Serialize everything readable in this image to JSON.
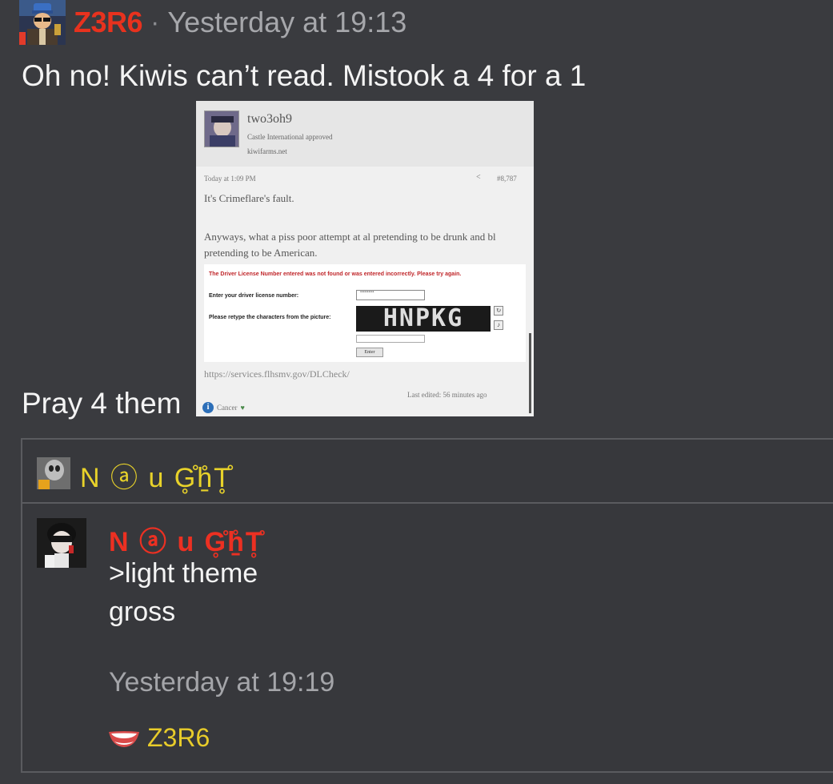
{
  "post": {
    "username": "Z3R6",
    "separator": "·",
    "timestamp": "Yesterday at 19:13",
    "text_line1": "Oh no! Kiwis can’t read. Mistook a 4 for a 1",
    "text_line2": "Pray 4 them"
  },
  "embed": {
    "username": "two3oh9",
    "subtitle1": "Castle International approved",
    "subtitle2": "kiwifarms.net",
    "date": "Today at 1:09 PM",
    "post_number": "#8,787",
    "line1": "It's Crimeflare's fault.",
    "line2": "Anyways, what a piss poor attempt at al pretending to be drunk and bl pretending to be American.",
    "form": {
      "error": "The Driver License Number entered was not found or was entered incorrectly. Please try again.",
      "label1": "Enter your driver license number:",
      "input1_value": "••••••••••",
      "label2": "Please retype the characters from the picture:",
      "captcha": "HNPKG",
      "button": "Enter"
    },
    "url": "https://services.flhsmv.gov/DLCheck/",
    "edited": "Last edited: 56 minutes ago",
    "reaction_label": "Cancer"
  },
  "quote": {
    "author": "N ⓐ u G̥̊ẖ̊T̥̊"
  },
  "reply": {
    "username": "N ⓐ u G̥̊ẖ̊T̥̊",
    "line1": ">light theme",
    "line2": "gross",
    "timestamp": "Yesterday at 19:19",
    "reaction_user": "Z3R6"
  }
}
